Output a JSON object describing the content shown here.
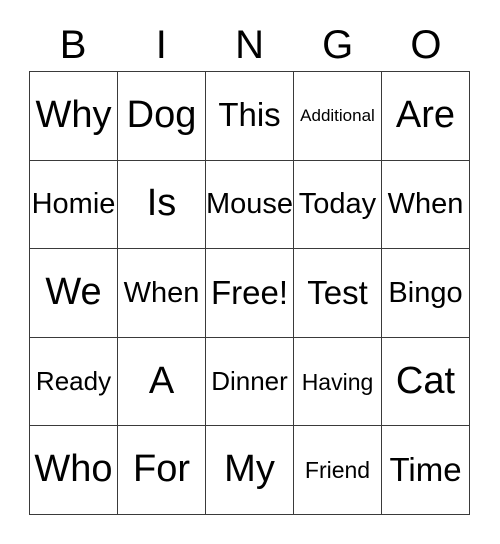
{
  "card": {
    "title_letters": [
      "B",
      "I",
      "N",
      "G",
      "O"
    ],
    "colors": {
      "background": "#ffffff",
      "text": "#000000",
      "border": "#3a3a3a"
    },
    "rows": [
      [
        {
          "text": "Why",
          "size": "fs-xl"
        },
        {
          "text": "Dog",
          "size": "fs-xl"
        },
        {
          "text": "This",
          "size": "fs-lg"
        },
        {
          "text": "Additional",
          "size": "fs-xxs"
        },
        {
          "text": "Are",
          "size": "fs-xl"
        }
      ],
      [
        {
          "text": "Homie",
          "size": "fs-md"
        },
        {
          "text": "Is",
          "size": "fs-xl"
        },
        {
          "text": "Mouse",
          "size": "fs-md"
        },
        {
          "text": "Today",
          "size": "fs-md"
        },
        {
          "text": "When",
          "size": "fs-md"
        }
      ],
      [
        {
          "text": "We",
          "size": "fs-xl"
        },
        {
          "text": "When",
          "size": "fs-md"
        },
        {
          "text": "Free!",
          "size": "fs-lg"
        },
        {
          "text": "Test",
          "size": "fs-lg"
        },
        {
          "text": "Bingo",
          "size": "fs-md"
        }
      ],
      [
        {
          "text": "Ready",
          "size": "fs-sm"
        },
        {
          "text": "A",
          "size": "fs-xl"
        },
        {
          "text": "Dinner",
          "size": "fs-sm"
        },
        {
          "text": "Having",
          "size": "fs-xs"
        },
        {
          "text": "Cat",
          "size": "fs-xl"
        }
      ],
      [
        {
          "text": "Who",
          "size": "fs-xl"
        },
        {
          "text": "For",
          "size": "fs-xl"
        },
        {
          "text": "My",
          "size": "fs-xl"
        },
        {
          "text": "Friend",
          "size": "fs-xs"
        },
        {
          "text": "Time",
          "size": "fs-lg"
        }
      ]
    ]
  }
}
